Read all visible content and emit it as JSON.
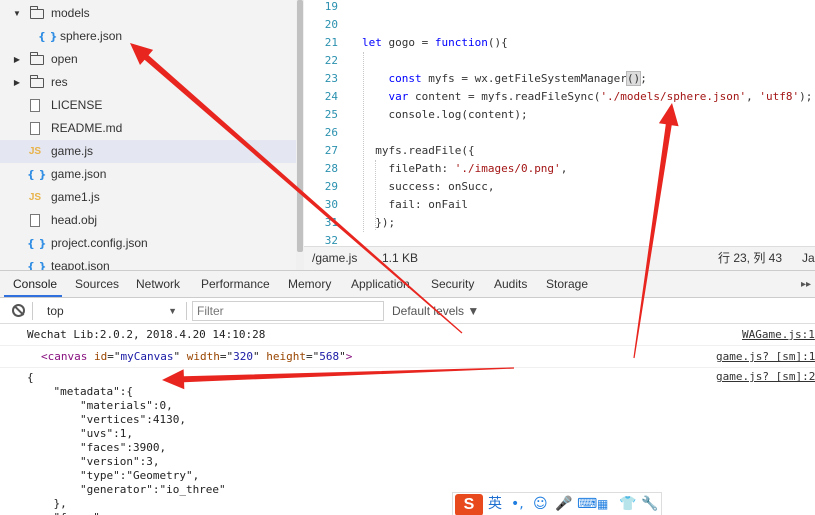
{
  "file_tree": {
    "items": [
      {
        "label": "models",
        "kind": "folder",
        "arrow": "▼"
      },
      {
        "label": "sphere.json",
        "kind": "json",
        "arrow": ""
      },
      {
        "label": "open",
        "kind": "folder",
        "arrow": "▶"
      },
      {
        "label": "res",
        "kind": "folder",
        "arrow": "▶"
      },
      {
        "label": "LICENSE",
        "kind": "file",
        "arrow": ""
      },
      {
        "label": "README.md",
        "kind": "file",
        "arrow": ""
      },
      {
        "label": "game.js",
        "kind": "js",
        "arrow": ""
      },
      {
        "label": "game.json",
        "kind": "json",
        "arrow": ""
      },
      {
        "label": "game1.js",
        "kind": "js",
        "arrow": ""
      },
      {
        "label": "head.obj",
        "kind": "file",
        "arrow": ""
      },
      {
        "label": "project.config.json",
        "kind": "json",
        "arrow": ""
      },
      {
        "label": "teapot.json",
        "kind": "json",
        "arrow": ""
      }
    ],
    "icons": {
      "js": "JS",
      "json": "{ }"
    }
  },
  "editor": {
    "lines": [
      {
        "n": "19",
        "html": ""
      },
      {
        "n": "20",
        "html": ""
      },
      {
        "n": "21",
        "html": "<span class=\"kw\">let</span> gogo = <span class=\"kw\">function</span>(){"
      },
      {
        "n": "22",
        "html": ""
      },
      {
        "n": "23",
        "html": "    <span class=\"kw\">const</span> myfs = wx.getFileSystemManager<span class=\"paren-hl\">()</span>;"
      },
      {
        "n": "24",
        "html": "    <span class=\"kw\">var</span> content = myfs.readFileSync(<span class=\"str\">'./models/sphere.json'</span>, <span class=\"str\">'utf8'</span>);"
      },
      {
        "n": "25",
        "html": "    console.log(content);"
      },
      {
        "n": "26",
        "html": ""
      },
      {
        "n": "27",
        "html": "  myfs.readFile({"
      },
      {
        "n": "28",
        "html": "    filePath: <span class=\"str\">'./images/0.png'</span>,"
      },
      {
        "n": "29",
        "html": "    success: onSucc,"
      },
      {
        "n": "30",
        "html": "    fail: onFail"
      },
      {
        "n": "31",
        "html": "  });"
      },
      {
        "n": "32",
        "html": ""
      }
    ]
  },
  "editor_status": {
    "file": "/game.js",
    "size": "1.1 KB",
    "position": "行 23, 列 43",
    "language": "Ja"
  },
  "devtools_tabs": [
    "Console",
    "Sources",
    "Network",
    "Performance",
    "Memory",
    "Application",
    "Security",
    "Audits",
    "Storage"
  ],
  "more_tabs_icon": "▸▸",
  "console_toolbar": {
    "context": "top",
    "context_arrow": "▼",
    "filter_placeholder": "Filter",
    "levels": "Default levels ▼"
  },
  "console": {
    "messages": [
      {
        "text": "Wechat Lib:2.0.2, 2018.4.20 14:10:28",
        "source": "WAGame.js:1"
      },
      {
        "source": "game.js? [sm]:1"
      },
      {
        "source": "game.js? [sm]:2"
      }
    ],
    "canvas_element": {
      "tag": "canvas",
      "attrs": [
        {
          "name": "id",
          "value": "myCanvas"
        },
        {
          "name": "width",
          "value": "320"
        },
        {
          "name": "height",
          "value": "568"
        }
      ]
    },
    "object_lines": [
      "{",
      "    \"metadata\":{",
      "        \"materials\":0,",
      "        \"vertices\":4130,",
      "        \"uvs\":1,",
      "        \"faces\":3900,",
      "        \"version\":3,",
      "        \"type\":\"Geometry\",",
      "        \"generator\":\"io_three\"",
      "    },",
      "    \"faces\":"
    ]
  },
  "ime_toolbar": {
    "logo": "S",
    "mode": "英",
    "items": [
      "•,",
      "☺",
      "🎤",
      "⌨",
      "👕",
      "🔧"
    ]
  },
  "colors": {
    "arrow_red": "#e8251f",
    "keyword": "#0000ff",
    "string": "#a31515",
    "line_number": "#2b91af",
    "active_tab_underline": "#2f6fde"
  }
}
